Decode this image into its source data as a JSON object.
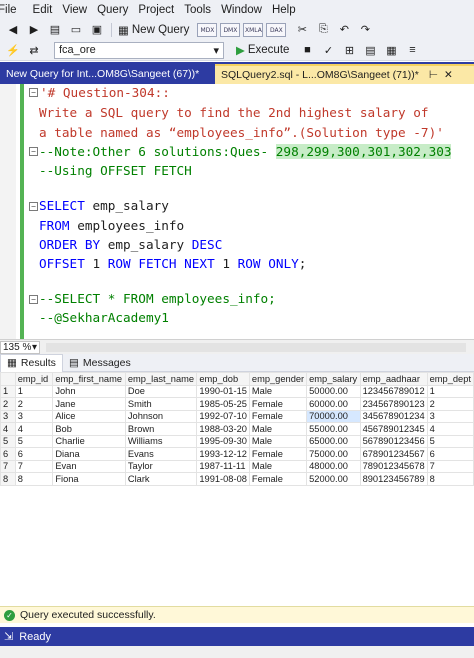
{
  "menu": [
    "File",
    "Edit",
    "View",
    "Query",
    "Project",
    "Tools",
    "Window",
    "Help"
  ],
  "toolbar": {
    "new_query": "New Query",
    "execute": "Execute"
  },
  "database": {
    "selected": "fca_ore"
  },
  "sql_icons": [
    "MDX",
    "DMX",
    "XMLA",
    "DAX"
  ],
  "tabs": [
    {
      "label": "New Query for Int...OM8G\\Sangeet (67))*"
    },
    {
      "label": "SQLQuery2.sql - L...OM8G\\Sangeet (71))*"
    }
  ],
  "code": {
    "l1": "'# Question-304::",
    "l2": "Write a SQL query to find the 2nd highest salary of",
    "l3": "a table named as “employees_info”.(Solution type -7)'",
    "l4a": "--Note:Other 6 solutions:Ques- ",
    "l4b": "298,299,300,301,302,303",
    "l5": "--Using OFFSET FETCH",
    "l6a": "SELECT",
    "l6b": " emp_salary",
    "l7a": "FROM",
    "l7b": " employees_info",
    "l8a": "ORDER BY",
    "l8b": " emp_salary ",
    "l8c": "DESC",
    "l9a": "OFFSET",
    "l9b": " 1 ",
    "l9c": "ROW FETCH NEXT",
    "l9d": " 1 ",
    "l9e": "ROW ONLY",
    "l9f": ";",
    "l10": "--SELECT * FROM employees_info;",
    "l11": "--@SekharAcademy1"
  },
  "zoom": "135 %",
  "result_tabs": {
    "results": "Results",
    "messages": "Messages"
  },
  "results": {
    "columns": [
      "emp_id",
      "emp_first_name",
      "emp_last_name",
      "emp_dob",
      "emp_gender",
      "emp_salary",
      "emp_aadhaar",
      "emp_dept"
    ],
    "rows": [
      [
        "1",
        "1",
        "John",
        "Doe",
        "1990-01-15",
        "Male",
        "50000.00",
        "123456789012",
        "1"
      ],
      [
        "2",
        "2",
        "Jane",
        "Smith",
        "1985-05-25",
        "Female",
        "60000.00",
        "234567890123",
        "2"
      ],
      [
        "3",
        "3",
        "Alice",
        "Johnson",
        "1992-07-10",
        "Female",
        "70000.00",
        "345678901234",
        "3"
      ],
      [
        "4",
        "4",
        "Bob",
        "Brown",
        "1988-03-20",
        "Male",
        "55000.00",
        "456789012345",
        "4"
      ],
      [
        "5",
        "5",
        "Charlie",
        "Williams",
        "1995-09-30",
        "Male",
        "65000.00",
        "567890123456",
        "5"
      ],
      [
        "6",
        "6",
        "Diana",
        "Evans",
        "1993-12-12",
        "Female",
        "75000.00",
        "678901234567",
        "6"
      ],
      [
        "7",
        "7",
        "Evan",
        "Taylor",
        "1987-11-11",
        "Male",
        "48000.00",
        "789012345678",
        "7"
      ],
      [
        "8",
        "8",
        "Fiona",
        "Clark",
        "1991-08-08",
        "Female",
        "52000.00",
        "890123456789",
        "8"
      ]
    ]
  },
  "message": "Query executed successfully.",
  "status": "Ready"
}
